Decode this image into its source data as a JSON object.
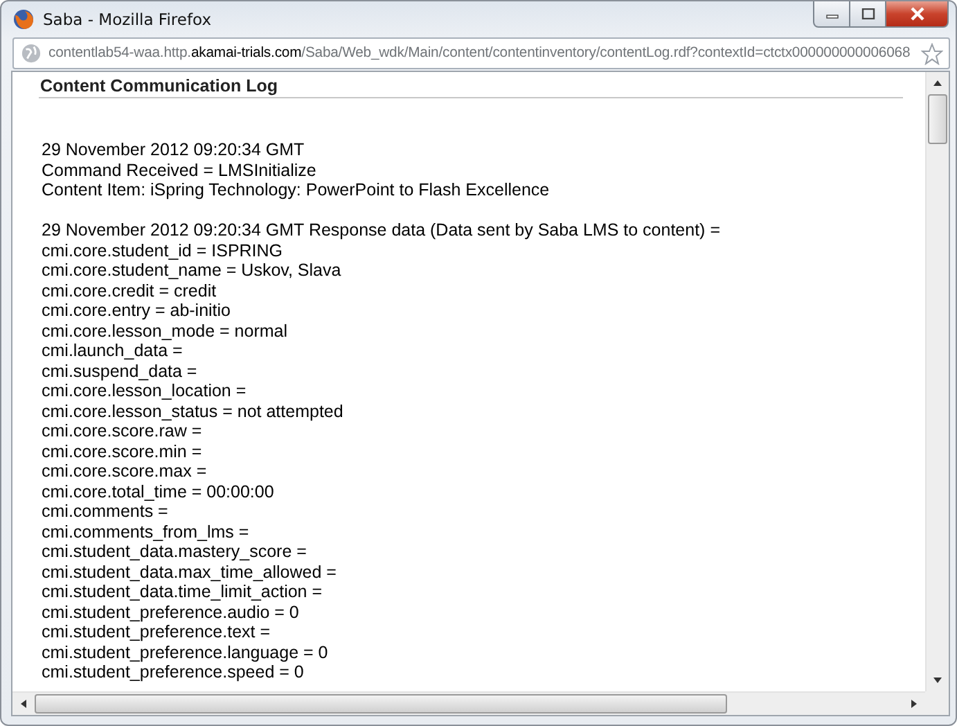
{
  "window": {
    "title": "Saba - Mozilla Firefox"
  },
  "address_bar": {
    "url": "contentlab54-waa.http.**akamai-trials.com**/Saba/Web_wdk/Main/content/contentinventory/contentLog.rdf?contextId=ctctx000000000006068"
  },
  "page": {
    "heading": "Content Communication Log",
    "entries": [
      {
        "lines": [
          "29 November 2012 09:20:34 GMT",
          "Command Received = LMSInitialize",
          "Content Item: iSpring Technology: PowerPoint to Flash Excellence"
        ]
      },
      {
        "lines": [
          "29 November 2012 09:20:34 GMT Response data (Data sent by Saba LMS to content) =",
          "cmi.core.student_id = ISPRING",
          "cmi.core.student_name = Uskov, Slava",
          "cmi.core.credit = credit",
          "cmi.core.entry = ab-initio",
          "cmi.core.lesson_mode = normal",
          "cmi.launch_data =",
          "cmi.suspend_data =",
          "cmi.core.lesson_location =",
          "cmi.core.lesson_status = not attempted",
          "cmi.core.score.raw =",
          "cmi.core.score.min =",
          "cmi.core.score.max =",
          "cmi.core.total_time = 00:00:00",
          "cmi.comments =",
          "cmi.comments_from_lms =",
          "cmi.student_data.mastery_score =",
          "cmi.student_data.max_time_allowed =",
          "cmi.student_data.time_limit_action =",
          "cmi.student_preference.audio = 0",
          "cmi.student_preference.text =",
          "cmi.student_preference.language = 0",
          "cmi.student_preference.speed = 0"
        ]
      }
    ]
  }
}
